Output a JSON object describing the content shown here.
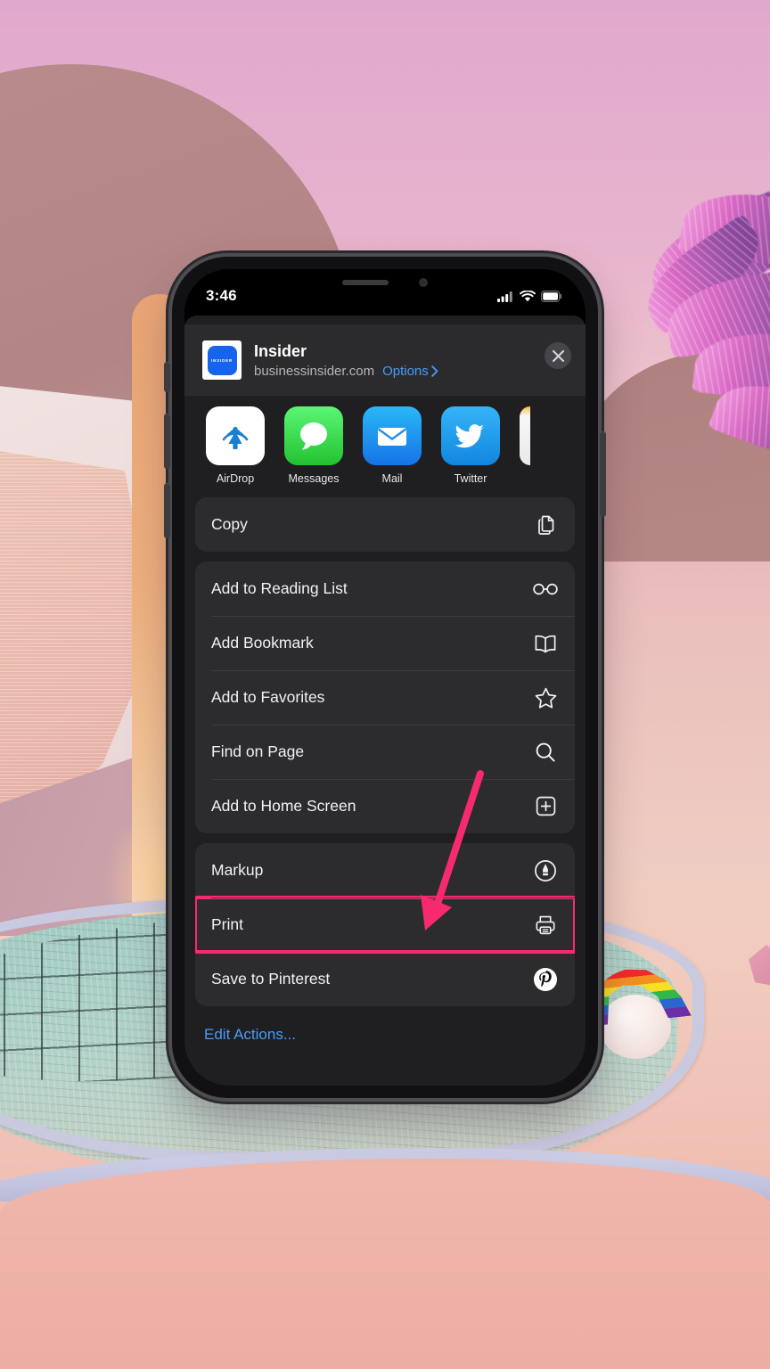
{
  "wallpaper": {
    "description": "pastel-pink desert pool scene with palm tree and rainbow float",
    "sky_color": "#e2abcf",
    "ground_color": "#f0c2b5",
    "pool_color": "#a8cfc6"
  },
  "phone": {
    "status_bar": {
      "time": "3:46",
      "cellular_icon": "cellular-bars-icon",
      "wifi_icon": "wifi-icon",
      "battery_icon": "battery-icon"
    }
  },
  "share_sheet": {
    "app_name": "Insider",
    "url": "businessinsider.com",
    "options_label": "Options",
    "options_chevron": "chevron-right-icon",
    "close_icon": "close-icon",
    "favicon_text": "INSIDER",
    "apps": [
      {
        "label": "AirDrop",
        "icon": "airdrop-icon",
        "color": "#ffffff"
      },
      {
        "label": "Messages",
        "icon": "messages-icon",
        "color": "#3ad152"
      },
      {
        "label": "Mail",
        "icon": "mail-icon",
        "color": "#1f8ef1"
      },
      {
        "label": "Twitter",
        "icon": "twitter-icon",
        "color": "#1da1f2"
      }
    ],
    "action_groups": [
      {
        "rows": [
          {
            "label": "Copy",
            "icon": "copy-icon",
            "highlighted": false
          }
        ]
      },
      {
        "rows": [
          {
            "label": "Add to Reading List",
            "icon": "glasses-icon",
            "highlighted": false
          },
          {
            "label": "Add Bookmark",
            "icon": "book-icon",
            "highlighted": false
          },
          {
            "label": "Add to Favorites",
            "icon": "star-icon",
            "highlighted": false
          },
          {
            "label": "Find on Page",
            "icon": "search-icon",
            "highlighted": false
          },
          {
            "label": "Add to Home Screen",
            "icon": "plus-square-icon",
            "highlighted": false
          }
        ]
      },
      {
        "rows": [
          {
            "label": "Markup",
            "icon": "markup-pen-icon",
            "highlighted": false
          },
          {
            "label": "Print",
            "icon": "printer-icon",
            "highlighted": true
          },
          {
            "label": "Save to Pinterest",
            "icon": "pinterest-icon",
            "highlighted": false
          }
        ]
      }
    ],
    "edit_actions_label": "Edit Actions..."
  },
  "annotation": {
    "arrow_color": "#f72a6f",
    "highlight_color": "#f72a6f",
    "highlighted_row_label": "Print"
  }
}
